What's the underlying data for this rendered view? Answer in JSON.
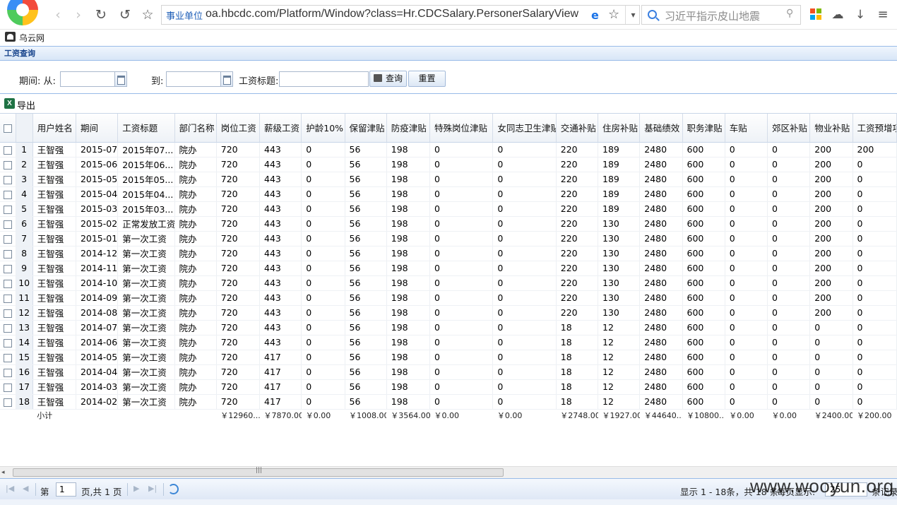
{
  "browser": {
    "url_badge": "事业单位",
    "url": "oa.hbcdc.com/Platform/Window?class=Hr.CDCSalary.PersonerSalaryView",
    "search_placeholder": "习近平指示皮山地震",
    "bookmark_label": "乌云网"
  },
  "panel": {
    "title": "工资查询"
  },
  "filter": {
    "period_label": "期间: 从:",
    "to_label": "到:",
    "title_label": "工资标题:",
    "search_button": "查询",
    "reset_button": "重置",
    "period_from": "",
    "period_to": "",
    "salary_title": ""
  },
  "toolbar": {
    "export_label": "导出",
    "excel_icon_text": "X"
  },
  "grid": {
    "columns": [
      "用户姓名",
      "期间",
      "工资标题",
      "部门名称",
      "岗位工资",
      "薪级工资",
      "护龄10%",
      "保留津贴",
      "防疫津贴",
      "特殊岗位津贴",
      "女同志卫生津贴",
      "交通补贴",
      "住房补贴",
      "基础绩效",
      "职务津贴",
      "车贴",
      "郊区补贴",
      "物业补贴",
      "工资预增项"
    ],
    "rows": [
      [
        "1",
        "王智强",
        "2015-07",
        "2015年07...",
        "院办",
        "720",
        "443",
        "0",
        "56",
        "198",
        "0",
        "0",
        "220",
        "189",
        "2480",
        "600",
        "0",
        "0",
        "200",
        "200"
      ],
      [
        "2",
        "王智强",
        "2015-06",
        "2015年06...",
        "院办",
        "720",
        "443",
        "0",
        "56",
        "198",
        "0",
        "0",
        "220",
        "189",
        "2480",
        "600",
        "0",
        "0",
        "200",
        "0"
      ],
      [
        "3",
        "王智强",
        "2015-05",
        "2015年05...",
        "院办",
        "720",
        "443",
        "0",
        "56",
        "198",
        "0",
        "0",
        "220",
        "189",
        "2480",
        "600",
        "0",
        "0",
        "200",
        "0"
      ],
      [
        "4",
        "王智强",
        "2015-04",
        "2015年04...",
        "院办",
        "720",
        "443",
        "0",
        "56",
        "198",
        "0",
        "0",
        "220",
        "189",
        "2480",
        "600",
        "0",
        "0",
        "200",
        "0"
      ],
      [
        "5",
        "王智强",
        "2015-03",
        "2015年03...",
        "院办",
        "720",
        "443",
        "0",
        "56",
        "198",
        "0",
        "0",
        "220",
        "189",
        "2480",
        "600",
        "0",
        "0",
        "200",
        "0"
      ],
      [
        "6",
        "王智强",
        "2015-02",
        "正常发放工资",
        "院办",
        "720",
        "443",
        "0",
        "56",
        "198",
        "0",
        "0",
        "220",
        "130",
        "2480",
        "600",
        "0",
        "0",
        "200",
        "0"
      ],
      [
        "7",
        "王智强",
        "2015-01",
        "第一次工资",
        "院办",
        "720",
        "443",
        "0",
        "56",
        "198",
        "0",
        "0",
        "220",
        "130",
        "2480",
        "600",
        "0",
        "0",
        "200",
        "0"
      ],
      [
        "8",
        "王智强",
        "2014-12",
        "第一次工资",
        "院办",
        "720",
        "443",
        "0",
        "56",
        "198",
        "0",
        "0",
        "220",
        "130",
        "2480",
        "600",
        "0",
        "0",
        "200",
        "0"
      ],
      [
        "9",
        "王智强",
        "2014-11",
        "第一次工资",
        "院办",
        "720",
        "443",
        "0",
        "56",
        "198",
        "0",
        "0",
        "220",
        "130",
        "2480",
        "600",
        "0",
        "0",
        "200",
        "0"
      ],
      [
        "10",
        "王智强",
        "2014-10",
        "第一次工资",
        "院办",
        "720",
        "443",
        "0",
        "56",
        "198",
        "0",
        "0",
        "220",
        "130",
        "2480",
        "600",
        "0",
        "0",
        "200",
        "0"
      ],
      [
        "11",
        "王智强",
        "2014-09",
        "第一次工资",
        "院办",
        "720",
        "443",
        "0",
        "56",
        "198",
        "0",
        "0",
        "220",
        "130",
        "2480",
        "600",
        "0",
        "0",
        "200",
        "0"
      ],
      [
        "12",
        "王智强",
        "2014-08",
        "第一次工资",
        "院办",
        "720",
        "443",
        "0",
        "56",
        "198",
        "0",
        "0",
        "220",
        "130",
        "2480",
        "600",
        "0",
        "0",
        "200",
        "0"
      ],
      [
        "13",
        "王智强",
        "2014-07",
        "第一次工资",
        "院办",
        "720",
        "443",
        "0",
        "56",
        "198",
        "0",
        "0",
        "18",
        "12",
        "2480",
        "600",
        "0",
        "0",
        "0",
        "0"
      ],
      [
        "14",
        "王智强",
        "2014-06",
        "第一次工资",
        "院办",
        "720",
        "443",
        "0",
        "56",
        "198",
        "0",
        "0",
        "18",
        "12",
        "2480",
        "600",
        "0",
        "0",
        "0",
        "0"
      ],
      [
        "15",
        "王智强",
        "2014-05",
        "第一次工资",
        "院办",
        "720",
        "417",
        "0",
        "56",
        "198",
        "0",
        "0",
        "18",
        "12",
        "2480",
        "600",
        "0",
        "0",
        "0",
        "0"
      ],
      [
        "16",
        "王智强",
        "2014-04",
        "第一次工资",
        "院办",
        "720",
        "417",
        "0",
        "56",
        "198",
        "0",
        "0",
        "18",
        "12",
        "2480",
        "600",
        "0",
        "0",
        "0",
        "0"
      ],
      [
        "17",
        "王智强",
        "2014-03",
        "第一次工资",
        "院办",
        "720",
        "417",
        "0",
        "56",
        "198",
        "0",
        "0",
        "18",
        "12",
        "2480",
        "600",
        "0",
        "0",
        "0",
        "0"
      ],
      [
        "18",
        "王智强",
        "2014-02",
        "第一次工资",
        "院办",
        "720",
        "417",
        "0",
        "56",
        "198",
        "0",
        "0",
        "18",
        "12",
        "2480",
        "600",
        "0",
        "0",
        "0",
        "0"
      ]
    ],
    "subtotal_label": "小计",
    "subtotals": [
      "",
      "",
      "",
      "￥12960...",
      "￥7870.00",
      "￥0.00",
      "￥1008.00",
      "￥3564.00",
      "￥0.00",
      "￥0.00",
      "￥2748.00",
      "￥1927.00",
      "￥44640...",
      "￥10800...",
      "￥0.00",
      "￥0.00",
      "￥2400.00",
      "￥200.00"
    ]
  },
  "pager": {
    "page_prefix": "第",
    "page_value": "1",
    "page_suffix": "页,共 1 页",
    "display_info": "显示 1 - 18条，共 18 条",
    "per_page_label": "每页显示:",
    "per_page_value": "25",
    "records_suffix": "条记录"
  },
  "watermark": "www.wooyun.org",
  "colors": {
    "header_border": "#99bbe8",
    "panel_title_text": "#15428b",
    "accent_blue": "#3b86d6"
  }
}
